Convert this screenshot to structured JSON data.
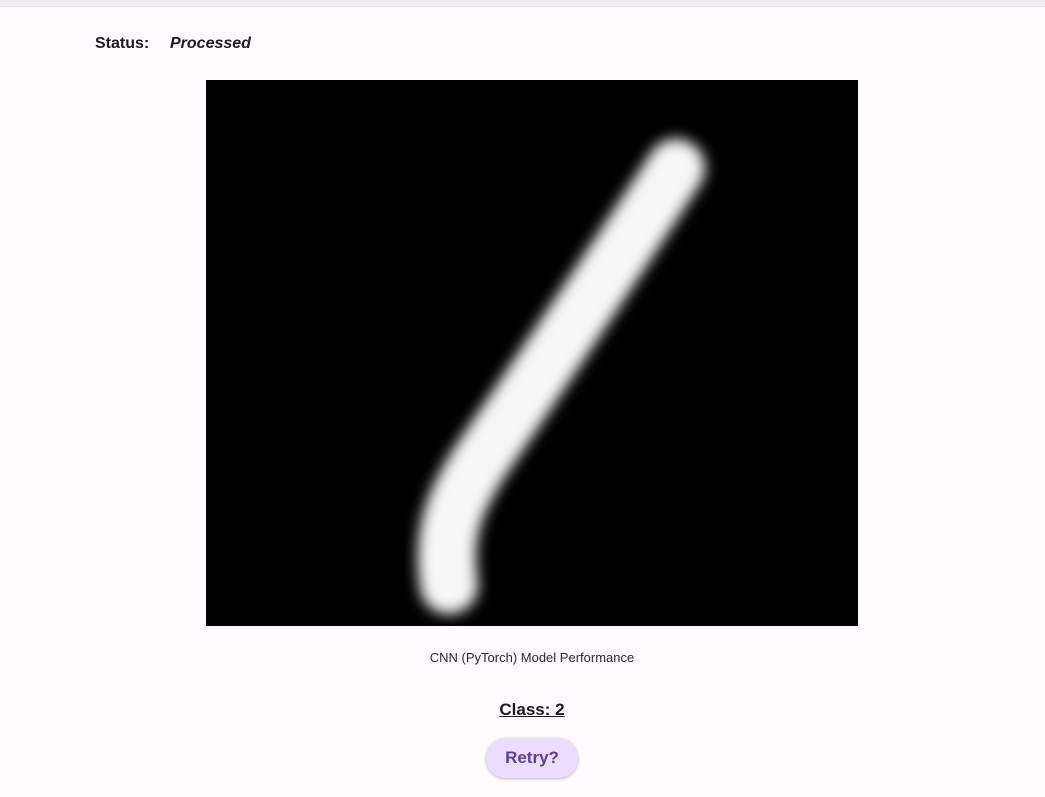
{
  "status": {
    "label": "Status:",
    "value": "Processed"
  },
  "image": {
    "icon": "handwritten-digit-image"
  },
  "caption": "CNN (PyTorch) Model Performance",
  "result": {
    "text": "Class: 2"
  },
  "retry": {
    "label": "Retry?"
  },
  "colors": {
    "background": "#fffbfe",
    "button_bg": "#eaddff",
    "button_text": "#5b3f9b"
  }
}
